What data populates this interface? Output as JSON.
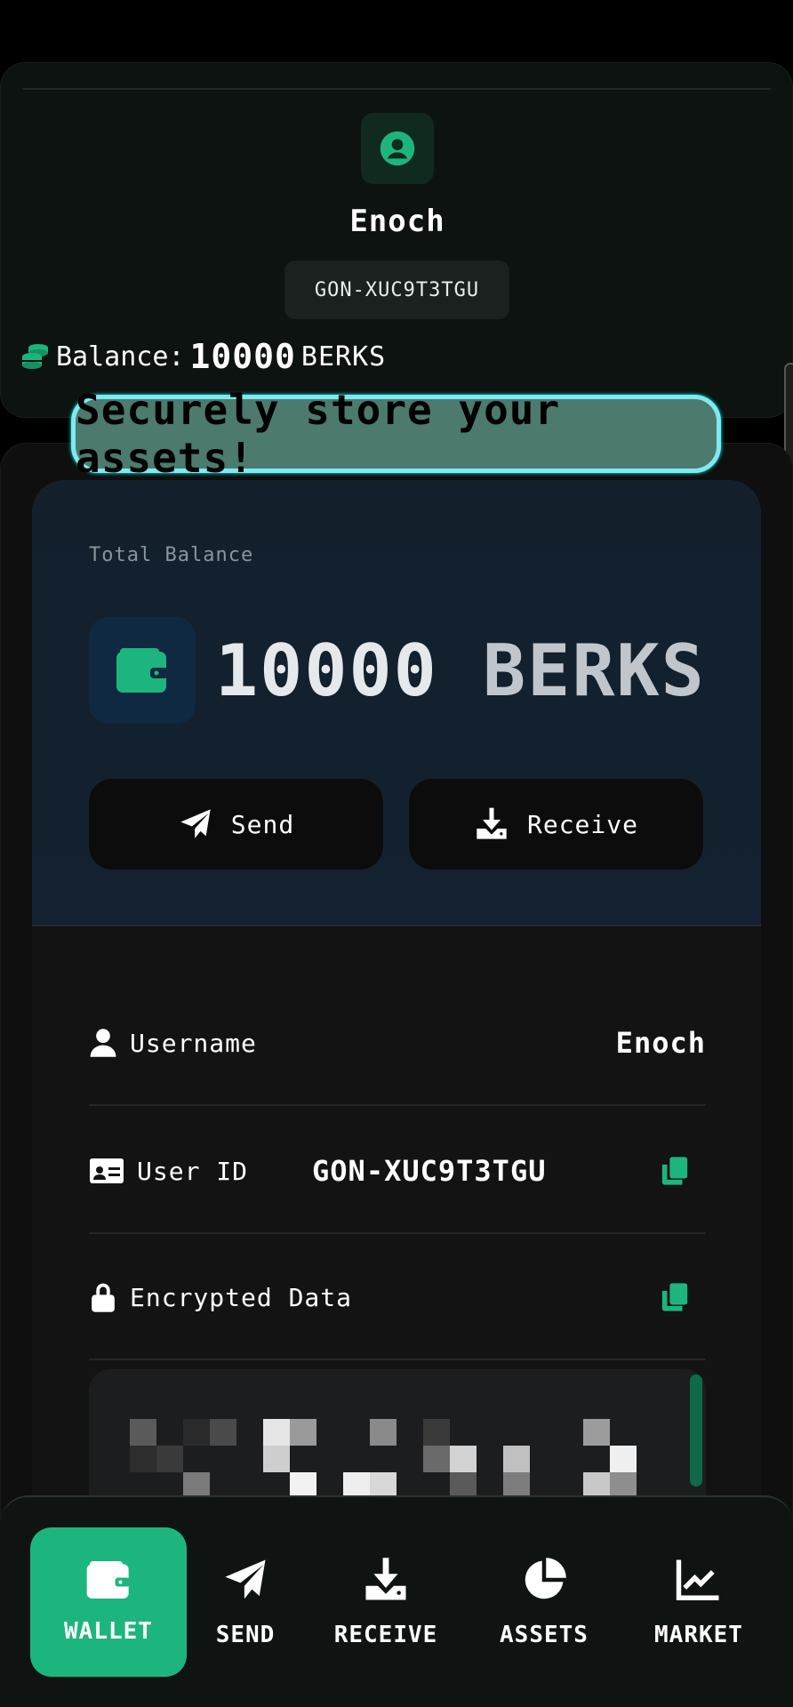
{
  "profile": {
    "name": "Enoch",
    "user_id": "GON-XUC9T3TGU",
    "balance_label": "Balance:",
    "balance_value": "10000",
    "currency": "BERKS"
  },
  "banner": {
    "text": "Securely store your assets!"
  },
  "wallet": {
    "total_label": "Total Balance",
    "amount": "10000",
    "currency": "BERKS",
    "send_label": "Send",
    "receive_label": "Receive"
  },
  "details": {
    "username_label": "Username",
    "username_value": "Enoch",
    "userid_label": "User ID",
    "userid_value": "GON-XUC9T3TGU",
    "encrypted_label": "Encrypted Data"
  },
  "nav": {
    "items": [
      {
        "label": "WALLET",
        "icon": "wallet-icon",
        "active": true
      },
      {
        "label": "SEND",
        "icon": "send-icon",
        "active": false
      },
      {
        "label": "RECEIVE",
        "icon": "receive-icon",
        "active": false
      },
      {
        "label": "ASSETS",
        "icon": "pie-chart-icon",
        "active": false
      },
      {
        "label": "MARKET",
        "icon": "line-chart-icon",
        "active": false
      }
    ]
  },
  "colors": {
    "accent": "#1db57e",
    "banner_bg": "#4d7a6e",
    "banner_border": "#7fe9ee",
    "card_head_bg": "#13202c"
  }
}
